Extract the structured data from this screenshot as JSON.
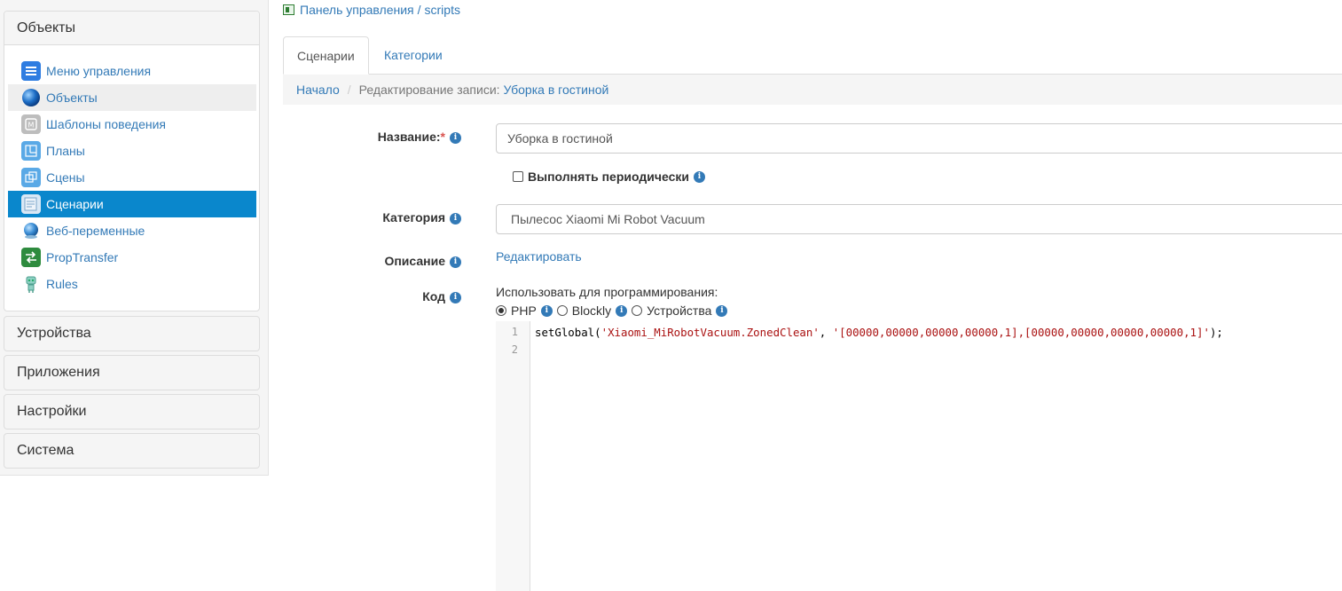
{
  "sidebar": {
    "open_panel": {
      "title": "Объекты",
      "items": [
        {
          "label": "Меню управления",
          "icon": "menu-icon"
        },
        {
          "label": "Объекты",
          "icon": "globe-icon"
        },
        {
          "label": "Шаблоны поведения",
          "icon": "template-icon"
        },
        {
          "label": "Планы",
          "icon": "plan-icon"
        },
        {
          "label": "Сцены",
          "icon": "scenes-icon"
        },
        {
          "label": "Сценарии",
          "icon": "scripts-icon"
        },
        {
          "label": "Веб-переменные",
          "icon": "web-globe-icon"
        },
        {
          "label": "PropTransfer",
          "icon": "transfer-icon"
        },
        {
          "label": "Rules",
          "icon": "robot-icon"
        }
      ]
    },
    "panels": [
      "Устройства",
      "Приложения",
      "Настройки",
      "Система"
    ]
  },
  "header": {
    "breadcrumb_home": "Панель управления",
    "breadcrumb_sep": "/",
    "breadcrumb_module": "scripts"
  },
  "tabs": [
    {
      "label": "Сценарии",
      "active": true
    },
    {
      "label": "Категории",
      "active": false
    }
  ],
  "breadcrumb": {
    "home": "Начало",
    "sep": "/",
    "editing": "Редактирование записи:",
    "record": "Уборка в гостиной"
  },
  "form": {
    "name_label": "Название:",
    "required_mark": "*",
    "name_value": "Уборка в гостиной",
    "periodic_label": "Выполнять периодически",
    "category_label": "Категория",
    "category_value": "Пылесос Xiaomi Mi Robot Vacuum",
    "description_label": "Описание",
    "description_link": "Редактировать",
    "code_label": "Код",
    "programming_label": "Использовать для программирования:",
    "modes": [
      {
        "label": "PHP",
        "selected": true
      },
      {
        "label": "Blockly",
        "selected": false
      },
      {
        "label": "Устройства",
        "selected": false
      }
    ]
  },
  "editor": {
    "line_numbers": [
      "1",
      "2"
    ],
    "code_fn": "setGlobal(",
    "code_arg1": "'Xiaomi_MiRobotVacuum.ZonedClean'",
    "code_comma": ", ",
    "code_arg2": "'[00000,00000,00000,00000,1],[00000,00000,00000,00000,1]'",
    "code_end": ");"
  },
  "colors": {
    "accent": "#337ab7",
    "active_menu": "#0a87cc",
    "string": "#aa1111"
  }
}
